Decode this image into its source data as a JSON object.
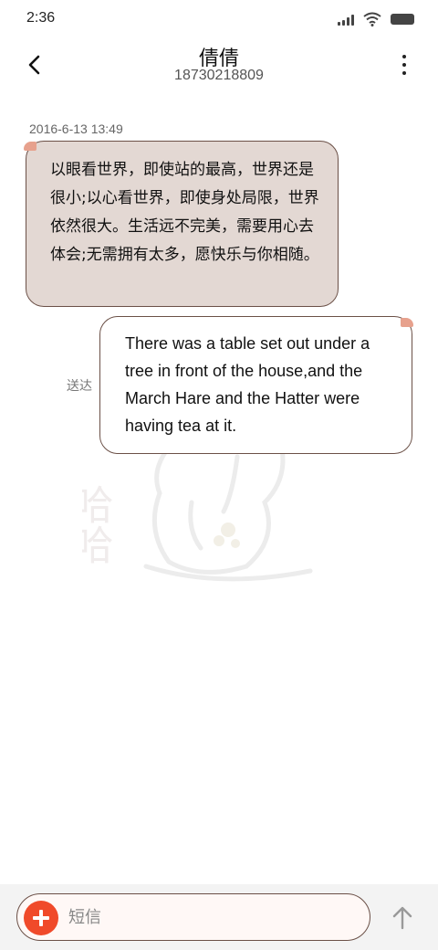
{
  "status_bar": {
    "time": "2:36",
    "icons": [
      "signal-icon",
      "wifi-icon",
      "battery-icon"
    ]
  },
  "header": {
    "contact_name": "倩倩",
    "contact_number": "18730218809",
    "icons": [
      "back-arrow-icon",
      "more-vertical-icon"
    ]
  },
  "conversation": {
    "timestamp": "2016-6-13 13:49",
    "incoming_message": "以眼看世界，即使站的最高，世界还是很小;以心看世界，即使身处局限，世界依然很大。生活远不完美，需要用心去体会;无需拥有太多，愿快乐与你相随。",
    "outgoing_message": "There was a table set out under a tree in front of the house,and the March Hare and the Hatter were having tea at it.",
    "delivery_status": "送达"
  },
  "watermark": {
    "text": "哈哈"
  },
  "composer": {
    "placeholder": "短信",
    "icons": [
      "plus-icon",
      "send-arrow-icon"
    ]
  },
  "colors": {
    "incoming_bubble": "#e3d8d3",
    "outgoing_bubble": "#ffffff",
    "bubble_border": "#6b5047",
    "bubble_tail": "#e7a18d",
    "add_button": "#f04a2a"
  }
}
